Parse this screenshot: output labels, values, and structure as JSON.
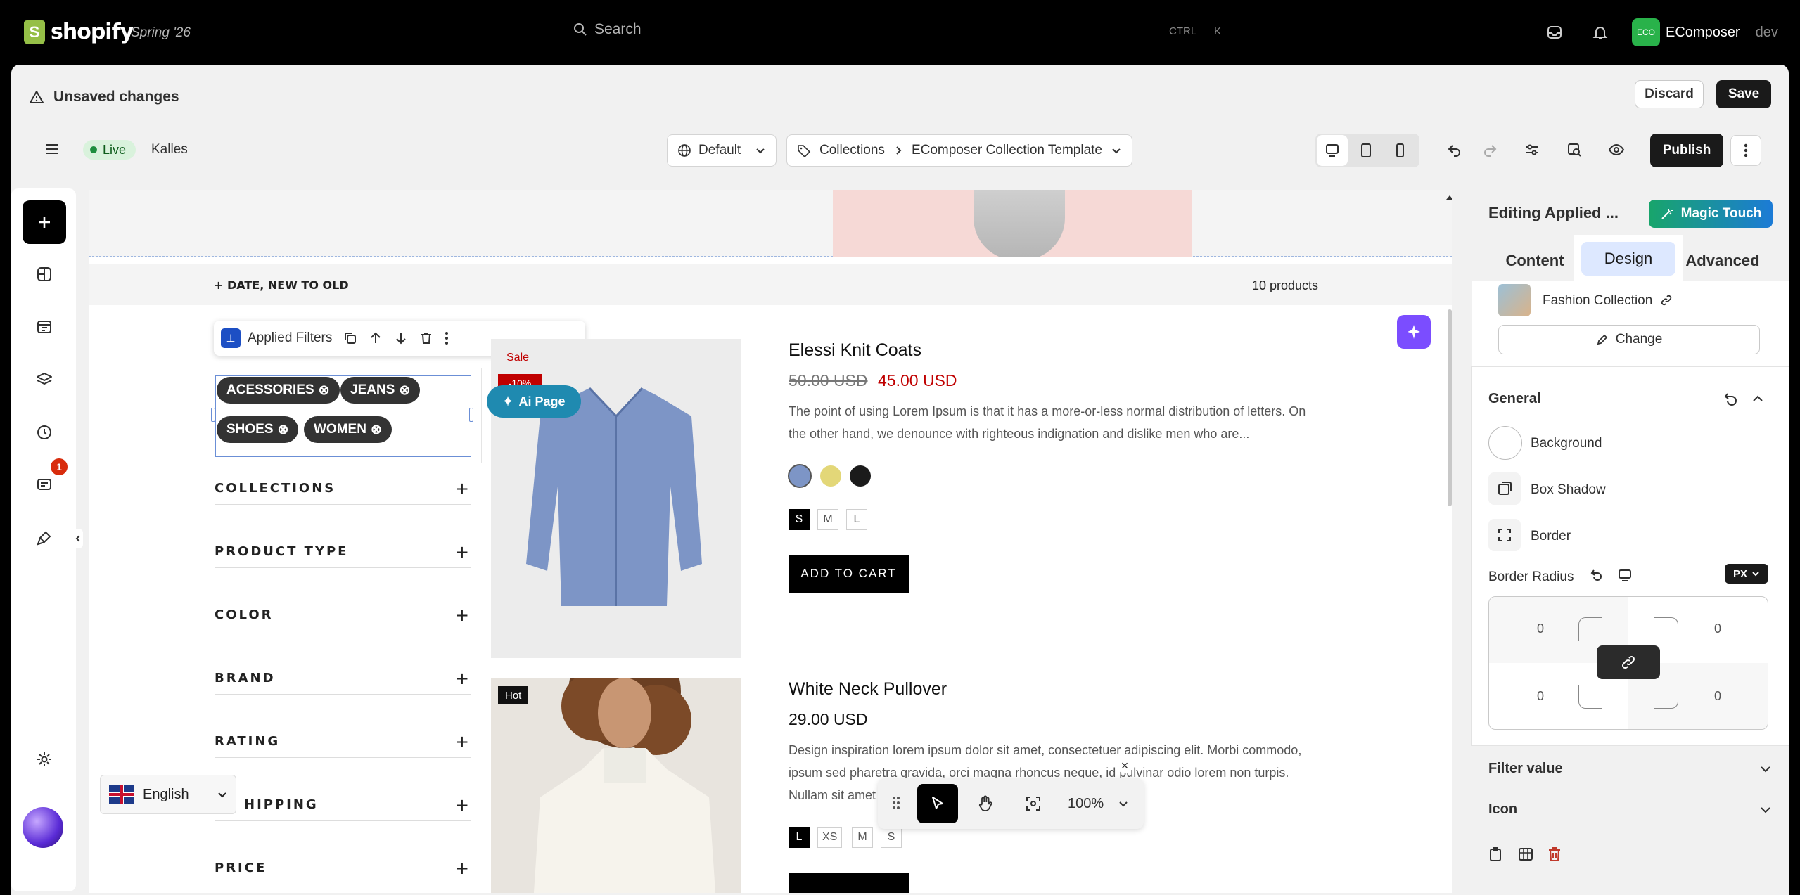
{
  "topbar": {
    "brand": "shopify",
    "season": "Spring '26",
    "search_placeholder": "Search",
    "shortcut_ctrl": "CTRL",
    "shortcut_key": "K",
    "store_avatar": "ECO",
    "store_name": "EComposer",
    "store_suffix": "dev"
  },
  "unsaved_bar": {
    "message": "Unsaved changes",
    "discard": "Discard",
    "save": "Save"
  },
  "editor_toolbar": {
    "status": "Live",
    "theme": "Kalles",
    "language_select": "Default",
    "breadcrumb_parent": "Collections",
    "breadcrumb_page": "EComposer Collection Template",
    "publish": "Publish"
  },
  "rail": {
    "notification_count": "1"
  },
  "canvas": {
    "sort_label": "+ DATE, NEW TO OLD",
    "product_count": "10 products",
    "element_toolbar_label": "Applied Filters",
    "ai_page": "Ai Page",
    "filter_tags": [
      "ACESSORIES",
      "JEANS",
      "SHOES",
      "WOMEN"
    ],
    "filter_groups": [
      "COLLECTIONS",
      "PRODUCT TYPE",
      "COLOR",
      "BRAND",
      "RATING",
      "HIPPING",
      "PRICE"
    ],
    "products": [
      {
        "badge": "Sale",
        "discount": "-10%",
        "title": "Elessi Knit Coats",
        "old_price": "50.00 USD",
        "price": "45.00 USD",
        "desc_line1": "The point of using Lorem Ipsum is that it has a more-or-less normal distribution of letters. On",
        "desc_line2": "the other hand, we denounce with righteous indignation and dislike men who are...",
        "sizes": [
          "S",
          "M",
          "L"
        ],
        "cta": "ADD TO CART"
      },
      {
        "badge": "Hot",
        "title": "White Neck Pullover",
        "price": "29.00 USD",
        "desc_line1": "Design inspiration lorem ipsum dolor sit amet, consectetuer adipiscing elit. Morbi commodo,",
        "desc_line2": "ipsum sed pharetra gravida, orci magna rhoncus neque, id pulvinar odio lorem non turpis.",
        "desc_line3": "Nullam sit amet",
        "sizes": [
          "L",
          "XS",
          "M",
          "S"
        ]
      }
    ],
    "language": "English",
    "zoom": "100%"
  },
  "panel": {
    "title": "Editing Applied ...",
    "magic_touch": "Magic Touch",
    "tabs": [
      "Content",
      "Design",
      "Advanced"
    ],
    "active_tab": "Design",
    "collection_name": "Fashion Collection",
    "change_button": "Change",
    "general_title": "General",
    "background": "Background",
    "box_shadow": "Box Shadow",
    "border": "Border",
    "border_radius_label": "Border Radius",
    "unit": "PX",
    "radius_values": [
      "0",
      "0",
      "0",
      "0"
    ],
    "filter_value_section": "Filter value",
    "icon_section": "Icon"
  },
  "colors": {
    "accent_green": "#1e8e3e",
    "sale_red": "#c00000",
    "ai_purple": "#7b4dff",
    "active_tab_bg": "#dde8ff"
  }
}
